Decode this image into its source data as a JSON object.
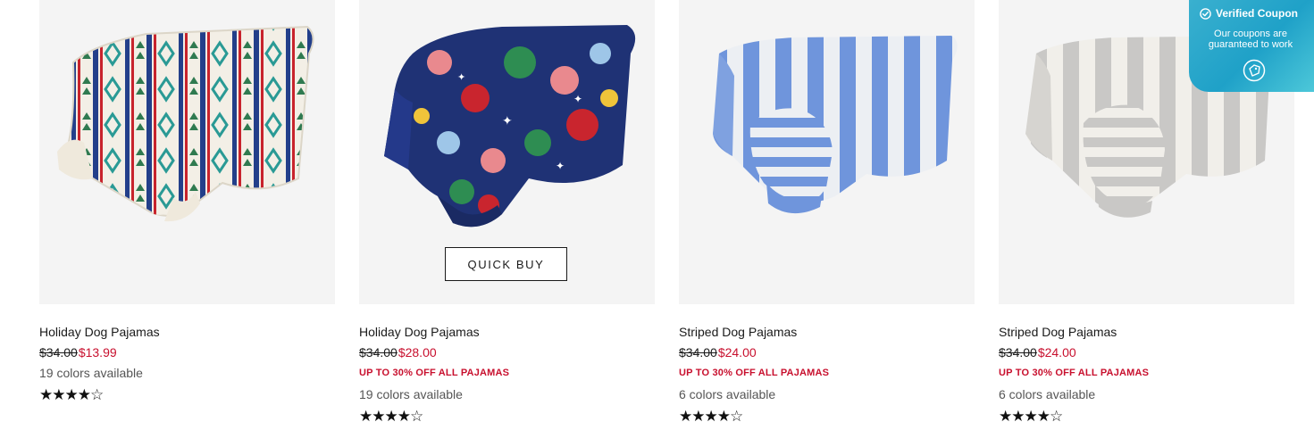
{
  "products": [
    {
      "title": "Holiday Dog Pajamas",
      "old_price": "$34.00",
      "sale_price": "$13.99",
      "promo": "",
      "colors": "19 colors available",
      "rating": 4.5,
      "stars": "★★★★☆"
    },
    {
      "title": "Holiday Dog Pajamas",
      "old_price": "$34.00",
      "sale_price": "$28.00",
      "promo": "UP TO 30% OFF ALL PAJAMAS",
      "colors": "19 colors available",
      "rating": 4.5,
      "stars": "★★★★☆",
      "quick_buy": "QUICK BUY"
    },
    {
      "title": "Striped Dog Pajamas",
      "old_price": "$34.00",
      "sale_price": "$24.00",
      "promo": "UP TO 30% OFF ALL PAJAMAS",
      "colors": "6 colors available",
      "rating": 4.5,
      "stars": "★★★★☆"
    },
    {
      "title": "Striped Dog Pajamas",
      "old_price": "$34.00",
      "sale_price": "$24.00",
      "promo": "UP TO 30% OFF ALL PAJAMAS",
      "colors": "6 colors available",
      "rating": 4.5,
      "stars": "★★★★☆"
    }
  ],
  "coupon": {
    "title": "Verified Coupon",
    "subtitle": "Our coupons are guaranteed to work",
    "icon": "coupon-tag-icon",
    "check_icon": "check-circle-icon"
  },
  "colors": {
    "sale_red": "#c8102e",
    "image_bg": "#f4f4f4",
    "coupon_teal": "#1fa1c8"
  }
}
